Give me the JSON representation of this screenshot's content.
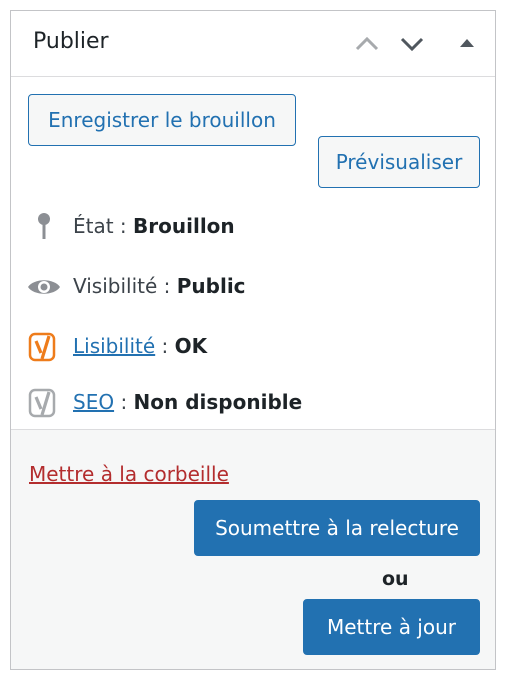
{
  "panel": {
    "title": "Publier",
    "icons": {
      "move_up": "chevron-up-icon",
      "move_down": "chevron-down-icon",
      "toggle": "triangle-up-icon"
    }
  },
  "actions": {
    "save_draft_label": "Enregistrer le brouillon",
    "preview_label": "Prévisualiser"
  },
  "status": {
    "state_label": "État :",
    "state_value": "Brouillon",
    "visibility_label": "Visibilité :",
    "visibility_value": "Public",
    "readability_link": "Lisibilité",
    "readability_sep": ":",
    "readability_value": "OK",
    "seo_link": "SEO",
    "seo_sep": ":",
    "seo_value": "Non disponible"
  },
  "footer": {
    "trash_label": "Mettre à la corbeille",
    "submit_review_label": "Soumettre à la relecture",
    "or_label": "ou",
    "update_label": "Mettre à jour"
  },
  "colors": {
    "accent": "#2271b1",
    "danger": "#b32d2e",
    "yoast_orange": "#ee7c1b",
    "yoast_gray": "#a7aaad"
  }
}
